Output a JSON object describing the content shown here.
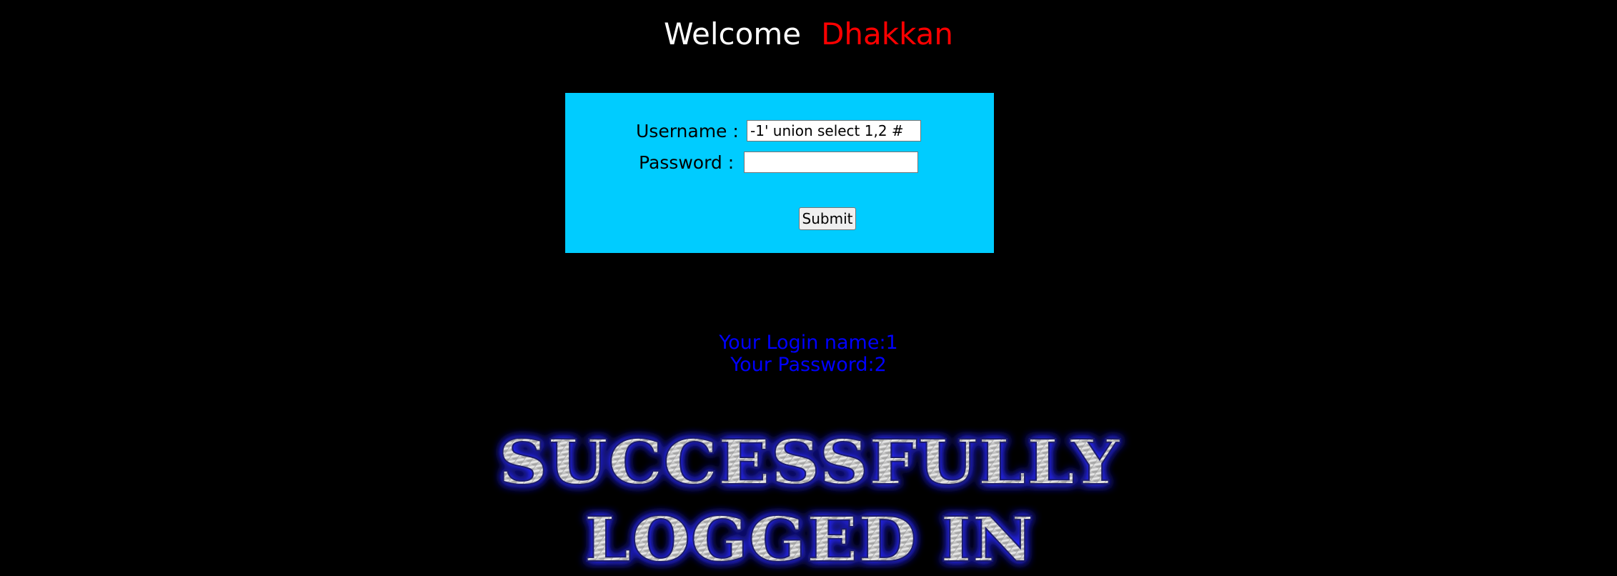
{
  "header": {
    "welcome_label": "Welcome",
    "user_name": "Dhakkan"
  },
  "form": {
    "username_label": "Username :",
    "username_value": "-1' union select 1,2 #",
    "password_label": "Password :",
    "password_value": "",
    "submit_label": "Submit"
  },
  "result": {
    "login_name": "Your Login name:1",
    "password": "Your Password:2"
  },
  "banner": {
    "line1": "SUCCESSFULLY",
    "line2": "LOGGED IN"
  },
  "colors": {
    "background": "#000000",
    "form_bg": "#00ccff",
    "welcome": "#ffffff",
    "user_name": "#ff0000",
    "result_text": "#0000ff",
    "banner_glow": "#2a2aff"
  }
}
